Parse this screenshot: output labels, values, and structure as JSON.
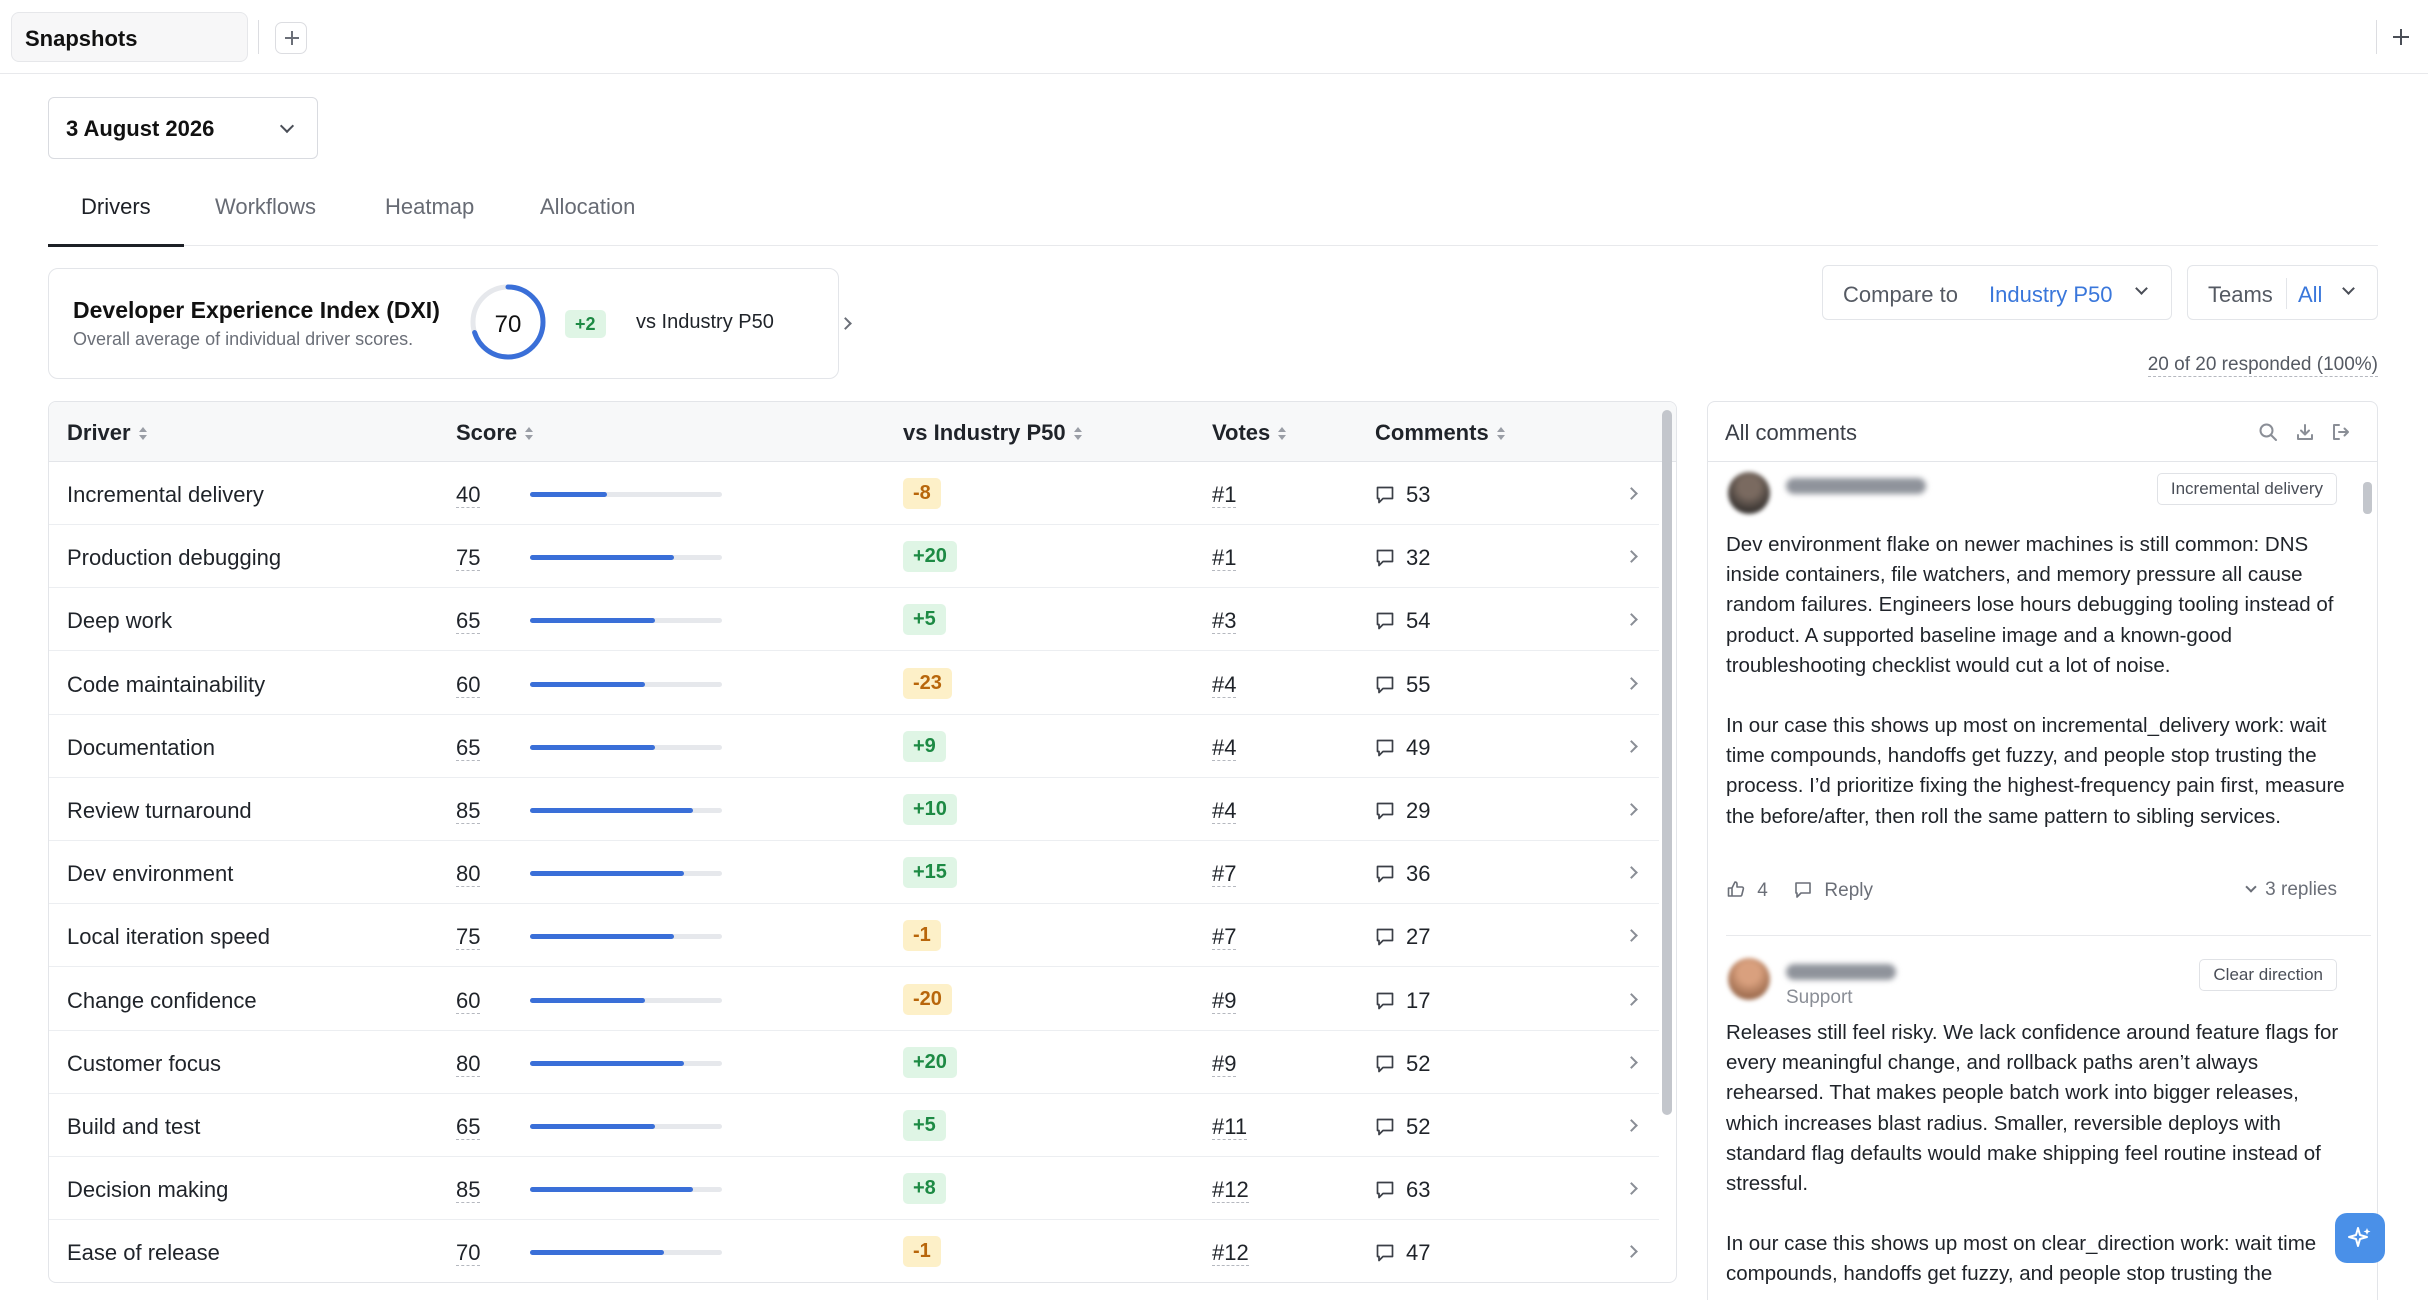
{
  "window": {
    "tab_label": "Snapshots"
  },
  "date_select": {
    "value": "3 August 2026"
  },
  "tabs": [
    {
      "label": "Drivers",
      "active": true
    },
    {
      "label": "Workflows",
      "active": false
    },
    {
      "label": "Heatmap",
      "active": false
    },
    {
      "label": "Allocation",
      "active": false
    }
  ],
  "dxi": {
    "title": "Developer Experience Index (DXI)",
    "subtitle": "Overall average of individual driver scores.",
    "score": "70",
    "score_fraction": 0.7,
    "delta": "+2",
    "vs_label": "vs Industry P50"
  },
  "filters": {
    "compare_label": "Compare to",
    "compare_value": "Industry P50",
    "teams_label": "Teams",
    "teams_value": "All",
    "responded": "20 of 20 responded (100%)"
  },
  "table": {
    "columns": [
      "Driver",
      "Score",
      "vs Industry P50",
      "Votes",
      "Comments"
    ],
    "rows": [
      {
        "driver": "Incremental delivery",
        "score": "40",
        "delta": "-8",
        "vote": "#1",
        "comments": "53"
      },
      {
        "driver": "Production debugging",
        "score": "75",
        "delta": "+20",
        "vote": "#1",
        "comments": "32"
      },
      {
        "driver": "Deep work",
        "score": "65",
        "delta": "+5",
        "vote": "#3",
        "comments": "54"
      },
      {
        "driver": "Code maintainability",
        "score": "60",
        "delta": "-23",
        "vote": "#4",
        "comments": "55"
      },
      {
        "driver": "Documentation",
        "score": "65",
        "delta": "+9",
        "vote": "#4",
        "comments": "49"
      },
      {
        "driver": "Review turnaround",
        "score": "85",
        "delta": "+10",
        "vote": "#4",
        "comments": "29"
      },
      {
        "driver": "Dev environment",
        "score": "80",
        "delta": "+15",
        "vote": "#7",
        "comments": "36"
      },
      {
        "driver": "Local iteration speed",
        "score": "75",
        "delta": "-1",
        "vote": "#7",
        "comments": "27"
      },
      {
        "driver": "Change confidence",
        "score": "60",
        "delta": "-20",
        "vote": "#9",
        "comments": "17"
      },
      {
        "driver": "Customer focus",
        "score": "80",
        "delta": "+20",
        "vote": "#9",
        "comments": "52"
      },
      {
        "driver": "Build and test",
        "score": "65",
        "delta": "+5",
        "vote": "#11",
        "comments": "52"
      },
      {
        "driver": "Decision making",
        "score": "85",
        "delta": "+8",
        "vote": "#12",
        "comments": "63"
      },
      {
        "driver": "Ease of release",
        "score": "70",
        "delta": "-1",
        "vote": "#12",
        "comments": "47"
      }
    ]
  },
  "comments_panel": {
    "title": "All comments",
    "comments": [
      {
        "tag": "Incremental delivery",
        "role": "",
        "paragraph1": "Dev environment flake on newer machines is still common: DNS inside containers, file watchers, and memory pressure all cause random failures. Engineers lose hours debugging tooling instead of product. A supported baseline image and a known-good troubleshooting checklist would cut a lot of noise.",
        "paragraph2": "In our case this shows up most on incremental_delivery work: wait time compounds, handoffs get fuzzy, and people stop trusting the process. I’d prioritize fixing the highest-frequency pain first, measure the before/after, then roll the same pattern to sibling services.",
        "likes": "4",
        "reply_label": "Reply",
        "replies": "3 replies"
      },
      {
        "tag": "Clear direction",
        "role": "Support",
        "paragraph1": "Releases still feel risky. We lack confidence around feature flags for every meaningful change, and rollback paths aren’t always rehearsed. That makes people batch work into bigger releases, which increases blast radius. Smaller, reversible deploys with standard flag defaults would make shipping feel routine instead of stressful.",
        "paragraph2": "In our case this shows up most on clear_direction work: wait time compounds, handoffs get fuzzy, and people stop trusting the process."
      }
    ]
  },
  "colors": {
    "accent": "#3a77db",
    "bar": "#3a6fd8",
    "positive_bg": "#dff5e5",
    "positive_fg": "#1d8a44",
    "negative_bg": "#fdf0c8",
    "negative_fg": "#b8660b"
  }
}
